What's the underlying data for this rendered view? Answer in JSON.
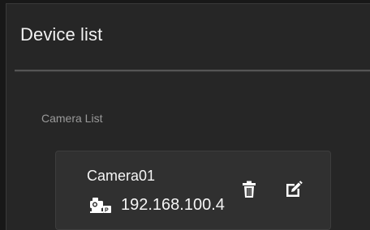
{
  "header": {
    "title": "Device list"
  },
  "section": {
    "label": "Camera List"
  },
  "cameras": [
    {
      "name": "Camera01",
      "ip": "192.168.100.4",
      "type_icon": "ip-camera-icon",
      "actions": [
        "trash-icon",
        "edit-icon"
      ]
    }
  ],
  "colors": {
    "background": "#262626",
    "card": "#303030",
    "text": "#f5f5f5",
    "muted": "#9a9a9a"
  }
}
